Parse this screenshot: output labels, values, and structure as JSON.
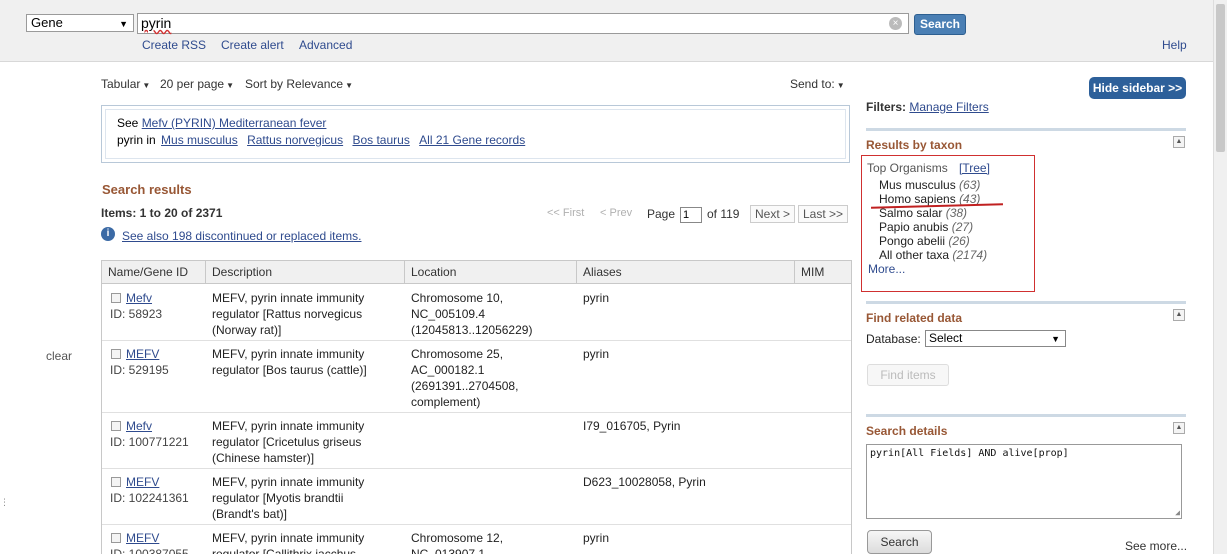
{
  "header": {
    "database": "Gene",
    "term": "pyrin",
    "search_label": "Search",
    "links": [
      "Create RSS",
      "Create alert",
      "Advanced"
    ],
    "help": "Help"
  },
  "toolbar": {
    "format": "Tabular",
    "per_page": "20 per page",
    "sort": "Sort by Relevance",
    "send_to": "Send to:"
  },
  "see_box": {
    "prefix": "See ",
    "link": "Mefv (PYRIN) Mediterranean fever",
    "pyrin_in": "pyrin in",
    "organisms": [
      "Mus musculus",
      "Rattus norvegicus",
      "Bos taurus"
    ],
    "all_records": "All 21 Gene records"
  },
  "results": {
    "title": "Search results",
    "items": "Items: 1 to 20 of 2371",
    "first": "<< First",
    "prev": "< Prev",
    "page_label": "Page",
    "page_value": "1",
    "of_pages": "of 119",
    "next": "Next >",
    "last": "Last >>",
    "see_also": "See also 198 discontinued or replaced items."
  },
  "table": {
    "columns": [
      "Name/Gene ID",
      "Description",
      "Location",
      "Aliases",
      "MIM"
    ],
    "rows": [
      {
        "name": "Mefv",
        "id": "ID: 58923",
        "desc1": "MEFV, pyrin innate immunity",
        "desc2": "regulator [Rattus norvegicus",
        "desc3": "(Norway rat)]",
        "loc1": "Chromosome 10,",
        "loc2": "NC_005109.4",
        "loc3": "(12045813..12056229)",
        "loc4": "",
        "alias": "pyrin"
      },
      {
        "name": "MEFV",
        "id": "ID: 529195",
        "desc1": "MEFV, pyrin innate immunity",
        "desc2": "regulator [Bos taurus (cattle)]",
        "desc3": "",
        "loc1": "Chromosome 25,",
        "loc2": "AC_000182.1",
        "loc3": "(2691391..2704508,",
        "loc4": "complement)",
        "alias": "pyrin"
      },
      {
        "name": "Mefv",
        "id": "ID: 100771221",
        "desc1": "MEFV, pyrin innate immunity",
        "desc2": "regulator [Cricetulus griseus",
        "desc3": "(Chinese hamster)]",
        "loc1": "",
        "loc2": "",
        "loc3": "",
        "loc4": "",
        "alias": "I79_016705, Pyrin"
      },
      {
        "name": "MEFV",
        "id": "ID: 102241361",
        "desc1": "MEFV, pyrin innate immunity",
        "desc2": "regulator [Myotis brandtii",
        "desc3": "(Brandt's bat)]",
        "loc1": "",
        "loc2": "",
        "loc3": "",
        "loc4": "",
        "alias": "D623_10028058, Pyrin"
      },
      {
        "name": "MEFV",
        "id": "ID: 100387055",
        "desc1": "MEFV, pyrin innate immunity",
        "desc2": "regulator [Callithrix jacchus",
        "desc3": "",
        "loc1": "Chromosome 12,",
        "loc2": "NC_013907.1",
        "loc3": "",
        "loc4": "",
        "alias": "pyrin"
      }
    ]
  },
  "left": {
    "clear": "clear"
  },
  "sidebar": {
    "hide": "Hide sidebar >>",
    "filters_label": "Filters:",
    "manage_filters": "Manage Filters",
    "taxon_title": "Results by taxon",
    "top_organisms": "Top Organisms",
    "tree": "[Tree]",
    "organisms": [
      {
        "name": "Mus musculus",
        "count": "(63)"
      },
      {
        "name": "Homo sapiens",
        "count": "(43)"
      },
      {
        "name": "Salmo salar",
        "count": "(38)"
      },
      {
        "name": "Papio anubis",
        "count": "(27)"
      },
      {
        "name": "Pongo abelii",
        "count": "(26)"
      },
      {
        "name": "All other taxa",
        "count": "(2174)"
      }
    ],
    "more": "More...",
    "related_title": "Find related data",
    "database_label": "Database:",
    "database_value": "Select",
    "find_items": "Find items",
    "details_title": "Search details",
    "details_query": "pyrin[All Fields] AND alive[prop]",
    "details_search": "Search",
    "see_more": "See more..."
  },
  "colors": {
    "accent": "#2d609a",
    "section_title": "#985735",
    "highlight": "#d03030"
  }
}
